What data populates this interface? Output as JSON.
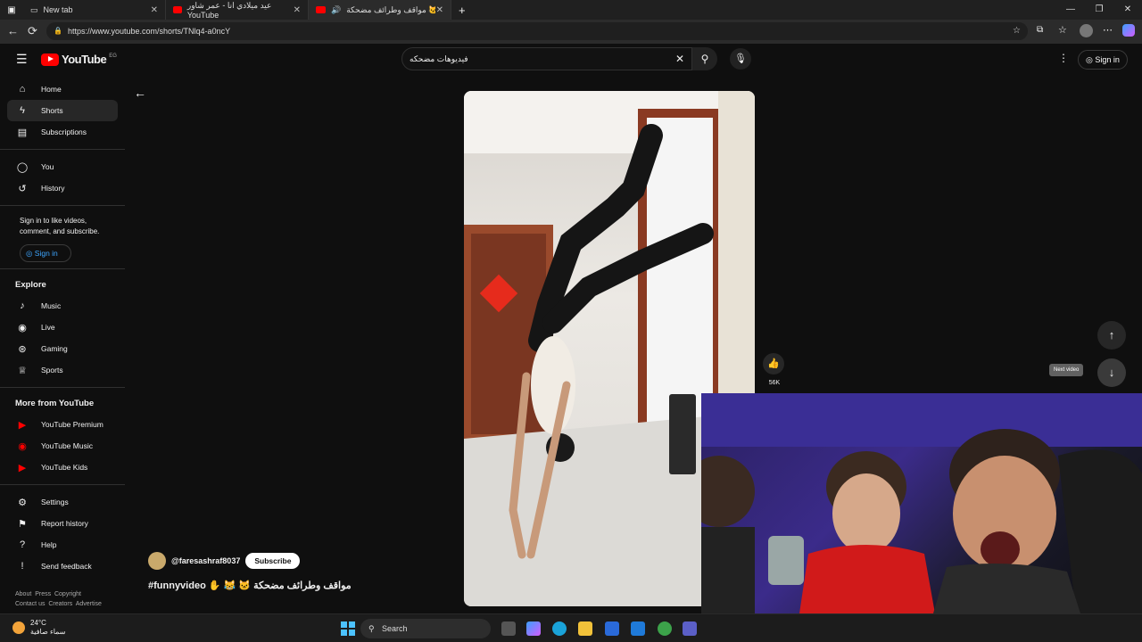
{
  "tabs": [
    {
      "title": "New tab",
      "active": false
    },
    {
      "title": "عيد ميلادي انا - عمر شاور YouTube",
      "active": false
    },
    {
      "title": "مواقف وطرائف مضحكة 🐱😹 -",
      "active": true
    }
  ],
  "address": {
    "url": "https://www.youtube.com/shorts/TNlq4-a0ncY"
  },
  "youtube": {
    "logo_text": "YouTube",
    "region": "EG",
    "search_value": "فيديوهات مضحكه",
    "signin_label": "Sign in"
  },
  "sidebar": {
    "main": [
      {
        "label": "Home",
        "icon": "home-icon"
      },
      {
        "label": "Shorts",
        "icon": "shorts-icon",
        "active": true
      },
      {
        "label": "Subscriptions",
        "icon": "subscriptions-icon"
      }
    ],
    "you": [
      {
        "label": "You",
        "icon": "user-icon"
      },
      {
        "label": "History",
        "icon": "history-icon"
      }
    ],
    "signin_note": "Sign in to like videos, comment, and subscribe.",
    "signin_label": "Sign in",
    "explore_title": "Explore",
    "explore": [
      {
        "label": "Music",
        "icon": "music-icon"
      },
      {
        "label": "Live",
        "icon": "live-icon"
      },
      {
        "label": "Gaming",
        "icon": "gaming-icon"
      },
      {
        "label": "Sports",
        "icon": "trophy-icon"
      }
    ],
    "more_title": "More from YouTube",
    "more": [
      {
        "label": "YouTube Premium"
      },
      {
        "label": "YouTube Music"
      },
      {
        "label": "YouTube Kids"
      }
    ],
    "settings": [
      {
        "label": "Settings",
        "icon": "gear-icon"
      },
      {
        "label": "Report history",
        "icon": "flag-icon"
      },
      {
        "label": "Help",
        "icon": "help-icon"
      },
      {
        "label": "Send feedback",
        "icon": "feedback-icon"
      }
    ],
    "footer": [
      "About",
      "Press",
      "Copyright",
      "Contact us",
      "Creators",
      "Advertise"
    ]
  },
  "short": {
    "channel": "@faresashraf8037",
    "subscribe_label": "Subscribe",
    "title": "#funnyvideo ✋ 😹 🐱 مواقف وطرائف مضحكة",
    "likes": "56K",
    "next_tooltip": "Next video"
  },
  "taskbar": {
    "temp": "24°C",
    "weather_text": "سماء صافية",
    "search_label": "Search"
  },
  "colors": {
    "accent": "#ff0000",
    "link": "#3ea6ff",
    "bg": "#0f0f0f"
  }
}
